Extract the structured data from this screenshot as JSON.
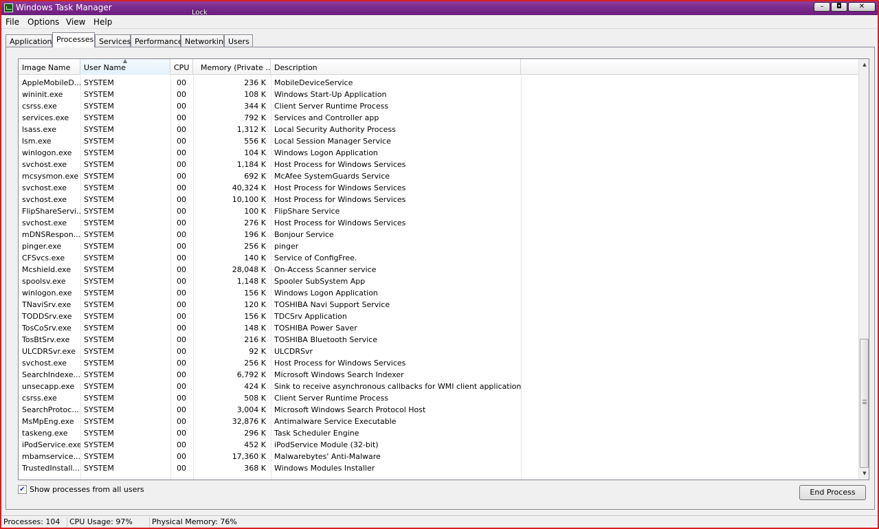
{
  "window": {
    "title": "Windows Task Manager",
    "overlay_label": "Lock",
    "caption_buttons": {
      "minimize": "–",
      "restore": "◘",
      "close": "✕"
    }
  },
  "menu": [
    "File",
    "Options",
    "View",
    "Help"
  ],
  "tabs": [
    {
      "label": "Applications",
      "active": false
    },
    {
      "label": "Processes",
      "active": true
    },
    {
      "label": "Services",
      "active": false
    },
    {
      "label": "Performance",
      "active": false
    },
    {
      "label": "Networking",
      "active": false
    },
    {
      "label": "Users",
      "active": false
    }
  ],
  "columns": {
    "image_name": "Image Name",
    "user_name": "User Name",
    "cpu": "CPU",
    "memory": "Memory (Private ...",
    "description": "Description"
  },
  "processes": [
    {
      "name": "AppleMobileD...",
      "user": "SYSTEM",
      "cpu": "00",
      "mem": "236 K",
      "desc": "MobileDeviceService"
    },
    {
      "name": "wininit.exe",
      "user": "SYSTEM",
      "cpu": "00",
      "mem": "108 K",
      "desc": "Windows Start-Up Application"
    },
    {
      "name": "csrss.exe",
      "user": "SYSTEM",
      "cpu": "00",
      "mem": "344 K",
      "desc": "Client Server Runtime Process"
    },
    {
      "name": "services.exe",
      "user": "SYSTEM",
      "cpu": "00",
      "mem": "792 K",
      "desc": "Services and Controller app"
    },
    {
      "name": "lsass.exe",
      "user": "SYSTEM",
      "cpu": "00",
      "mem": "1,312 K",
      "desc": "Local Security Authority Process"
    },
    {
      "name": "lsm.exe",
      "user": "SYSTEM",
      "cpu": "00",
      "mem": "556 K",
      "desc": "Local Session Manager Service"
    },
    {
      "name": "winlogon.exe",
      "user": "SYSTEM",
      "cpu": "00",
      "mem": "104 K",
      "desc": "Windows Logon Application"
    },
    {
      "name": "svchost.exe",
      "user": "SYSTEM",
      "cpu": "00",
      "mem": "1,184 K",
      "desc": "Host Process for Windows Services"
    },
    {
      "name": "mcsysmon.exe",
      "user": "SYSTEM",
      "cpu": "00",
      "mem": "692 K",
      "desc": "McAfee SystemGuards Service"
    },
    {
      "name": "svchost.exe",
      "user": "SYSTEM",
      "cpu": "00",
      "mem": "40,324 K",
      "desc": "Host Process for Windows Services"
    },
    {
      "name": "svchost.exe",
      "user": "SYSTEM",
      "cpu": "00",
      "mem": "10,100 K",
      "desc": "Host Process for Windows Services"
    },
    {
      "name": "FlipShareServi...",
      "user": "SYSTEM",
      "cpu": "00",
      "mem": "100 K",
      "desc": "FlipShare Service"
    },
    {
      "name": "svchost.exe",
      "user": "SYSTEM",
      "cpu": "00",
      "mem": "276 K",
      "desc": "Host Process for Windows Services"
    },
    {
      "name": "mDNSRespon...",
      "user": "SYSTEM",
      "cpu": "00",
      "mem": "196 K",
      "desc": "Bonjour Service"
    },
    {
      "name": "pinger.exe",
      "user": "SYSTEM",
      "cpu": "00",
      "mem": "256 K",
      "desc": "pinger"
    },
    {
      "name": "CFSvcs.exe",
      "user": "SYSTEM",
      "cpu": "00",
      "mem": "140 K",
      "desc": "Service of ConfigFree."
    },
    {
      "name": "Mcshield.exe",
      "user": "SYSTEM",
      "cpu": "00",
      "mem": "28,048 K",
      "desc": "On-Access Scanner service"
    },
    {
      "name": "spoolsv.exe",
      "user": "SYSTEM",
      "cpu": "00",
      "mem": "1,148 K",
      "desc": "Spooler SubSystem App"
    },
    {
      "name": "winlogon.exe",
      "user": "SYSTEM",
      "cpu": "00",
      "mem": "156 K",
      "desc": "Windows Logon Application"
    },
    {
      "name": "TNaviSrv.exe",
      "user": "SYSTEM",
      "cpu": "00",
      "mem": "120 K",
      "desc": "TOSHIBA Navi Support Service"
    },
    {
      "name": "TODDSrv.exe",
      "user": "SYSTEM",
      "cpu": "00",
      "mem": "156 K",
      "desc": "TDCSrv Application"
    },
    {
      "name": "TosCoSrv.exe",
      "user": "SYSTEM",
      "cpu": "00",
      "mem": "148 K",
      "desc": "TOSHIBA Power Saver"
    },
    {
      "name": "TosBtSrv.exe",
      "user": "SYSTEM",
      "cpu": "00",
      "mem": "216 K",
      "desc": "TOSHIBA Bluetooth Service"
    },
    {
      "name": "ULCDRSvr.exe",
      "user": "SYSTEM",
      "cpu": "00",
      "mem": "92 K",
      "desc": "ULCDRSvr"
    },
    {
      "name": "svchost.exe",
      "user": "SYSTEM",
      "cpu": "00",
      "mem": "256 K",
      "desc": "Host Process for Windows Services"
    },
    {
      "name": "SearchIndexe...",
      "user": "SYSTEM",
      "cpu": "00",
      "mem": "6,792 K",
      "desc": "Microsoft Windows Search Indexer"
    },
    {
      "name": "unsecapp.exe",
      "user": "SYSTEM",
      "cpu": "00",
      "mem": "424 K",
      "desc": "Sink to receive asynchronous callbacks for WMI client application"
    },
    {
      "name": "csrss.exe",
      "user": "SYSTEM",
      "cpu": "00",
      "mem": "508 K",
      "desc": "Client Server Runtime Process"
    },
    {
      "name": "SearchProtoc...",
      "user": "SYSTEM",
      "cpu": "00",
      "mem": "3,004 K",
      "desc": "Microsoft Windows Search Protocol Host"
    },
    {
      "name": "MsMpEng.exe",
      "user": "SYSTEM",
      "cpu": "00",
      "mem": "32,876 K",
      "desc": "Antimalware Service Executable"
    },
    {
      "name": "taskeng.exe",
      "user": "SYSTEM",
      "cpu": "00",
      "mem": "296 K",
      "desc": "Task Scheduler Engine"
    },
    {
      "name": "iPodService.exe",
      "user": "SYSTEM",
      "cpu": "00",
      "mem": "452 K",
      "desc": "iPodService Module (32-bit)"
    },
    {
      "name": "mbamservice....",
      "user": "SYSTEM",
      "cpu": "00",
      "mem": "17,360 K",
      "desc": "Malwarebytes' Anti-Malware"
    },
    {
      "name": "TrustedInstall...",
      "user": "SYSTEM",
      "cpu": "00",
      "mem": "368 K",
      "desc": "Windows Modules Installer"
    }
  ],
  "show_all_users": {
    "label": "Show processes from all users",
    "checked": true,
    "mark": "✔"
  },
  "end_process_label": "End Process",
  "status": {
    "processes": "Processes: 104",
    "cpu_usage": "CPU Usage: 97%",
    "physical_memory": "Physical Memory: 76%"
  },
  "colors": {
    "titlebar": "#7a2a8c",
    "window_border": "#d62020"
  },
  "icons": {
    "app": "task-manager-icon",
    "sort": "sort-arrow-icon",
    "scroll_up": "scroll-up-icon",
    "scroll_down": "scroll-down-icon"
  }
}
